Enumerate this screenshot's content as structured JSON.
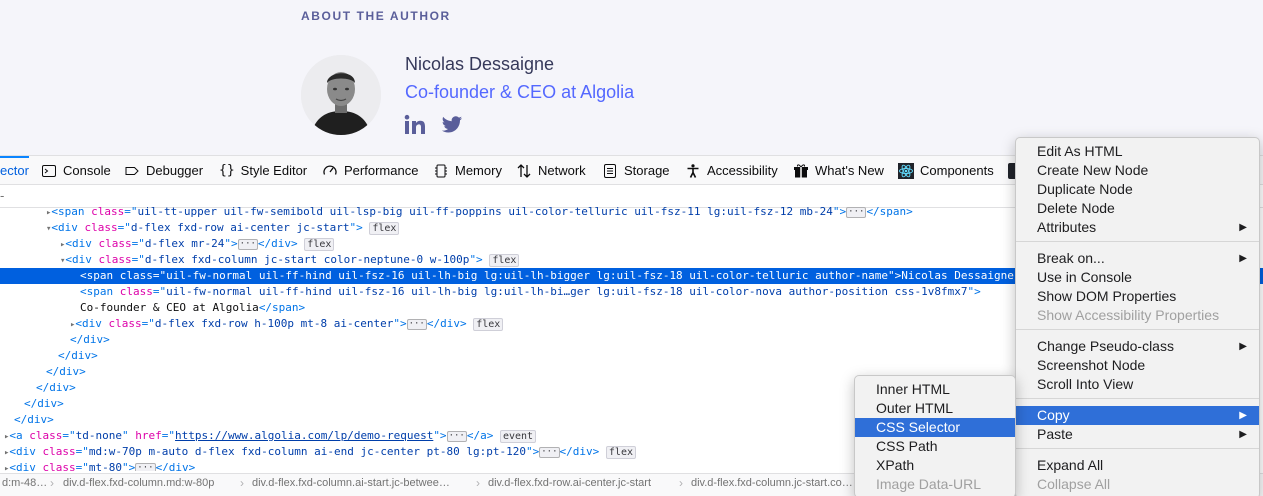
{
  "page": {
    "section_label": "ABOUT THE AUTHOR",
    "author_name": "Nicolas Dessaigne",
    "author_position": "Co-founder & CEO at Algolia",
    "colors": {
      "name": "#36395a",
      "position": "#5468ff",
      "section": "#5a5e9a",
      "social": "#5a5e9a"
    }
  },
  "toolbar": {
    "tabs": [
      {
        "label": "ector",
        "icon": "inspector-icon"
      },
      {
        "label": "Console",
        "icon": "console-icon"
      },
      {
        "label": "Debugger",
        "icon": "debugger-icon"
      },
      {
        "label": "Style Editor",
        "icon": "style-editor-icon"
      },
      {
        "label": "Performance",
        "icon": "performance-icon"
      },
      {
        "label": "Memory",
        "icon": "memory-icon"
      },
      {
        "label": "Network",
        "icon": "network-icon"
      },
      {
        "label": "Storage",
        "icon": "storage-icon"
      },
      {
        "label": "Accessibility",
        "icon": "accessibility-icon"
      },
      {
        "label": "What's New",
        "icon": "whats-new-icon"
      },
      {
        "label": "Components",
        "icon": "react-icon"
      }
    ],
    "active_tab": "ector",
    "search_placeholder": "-"
  },
  "markup": {
    "lines": [
      {
        "text_tag": "span",
        "class": "uil-tt-upper uil-fw-semibold uil-lsp-big uil-ff-poppins uil-color-telluric uil-fsz-11 lg:uil-fsz-12 mb-24",
        "close": "</span>"
      },
      {
        "text_tag": "div",
        "class": "d-flex fxd-row ai-center jc-start",
        "badge": "flex"
      },
      {
        "text_tag": "div",
        "class": "d-flex mr-24",
        "close": "</div>",
        "badge": "flex"
      },
      {
        "text_tag": "div",
        "class": "d-flex fxd-column jc-start color-neptune-0 w-100p",
        "badge": "flex"
      },
      {
        "text_tag": "span",
        "class": "uil-fw-normal uil-ff-hind uil-fsz-16 uil-lh-big lg:uil-lh-bigger lg:uil-fsz-18 uil-color-telluric author-name",
        "content": "Nicolas Dessaigne"
      },
      {
        "text_tag": "span",
        "class": "uil-fw-normal uil-ff-hind uil-fsz-16 uil-lh-big lg:uil-lh-bi…ger lg:uil-fsz-18 uil-color-nova author-position css-1v8fmx7"
      },
      {
        "content": "Co-founder & CEO at Algolia",
        "close": "</span>"
      },
      {
        "text_tag": "div",
        "class": "d-flex fxd-row h-100p mt-8 ai-center",
        "close": "</div>",
        "badge": "flex"
      },
      {
        "close": "</div>"
      },
      {
        "close": "</div>"
      },
      {
        "close": "</div>"
      },
      {
        "close": "</div>"
      },
      {
        "close": "</div>"
      },
      {
        "close": "</div>"
      },
      {
        "text_tag": "a",
        "class": "td-none",
        "href_label": "href",
        "href": "https://www.algolia.com/lp/demo-request",
        "close": "</a>",
        "badge": "event"
      },
      {
        "text_tag": "div",
        "class": "md:w-70p m-auto d-flex fxd-column ai-end jc-center pt-80 lg:pt-120",
        "close": "</div>",
        "badge": "flex"
      },
      {
        "text_tag": "div",
        "class": "mt-80",
        "close": "</div>"
      }
    ]
  },
  "breadcrumbs": [
    "d:m-48…",
    "div.d-flex.fxd-column.md:w-80p",
    "div.d-flex.fxd-column.ai-start.jc-betwee…",
    "div.d-flex.fxd-row.ai-center.jc-start",
    "div.d-flex.fxd-column.jc-start.co…"
  ],
  "main_menu": {
    "items": [
      {
        "label": "Edit As HTML"
      },
      {
        "label": "Create New Node"
      },
      {
        "label": "Duplicate Node"
      },
      {
        "label": "Delete Node"
      },
      {
        "label": "Attributes",
        "submenu": true
      },
      {
        "label": "Break on...",
        "submenu": true
      },
      {
        "label": "Use in Console"
      },
      {
        "label": "Show DOM Properties"
      },
      {
        "label": "Show Accessibility Properties",
        "disabled": true
      },
      {
        "label": "Change Pseudo-class",
        "submenu": true
      },
      {
        "label": "Screenshot Node"
      },
      {
        "label": "Scroll Into View"
      },
      {
        "label": "Copy",
        "submenu": true,
        "highlighted": true
      },
      {
        "label": "Paste",
        "submenu": true
      },
      {
        "label": "Expand All"
      },
      {
        "label": "Collapse All",
        "disabled": true
      }
    ]
  },
  "copy_submenu": {
    "items": [
      {
        "label": "Inner HTML"
      },
      {
        "label": "Outer HTML"
      },
      {
        "label": "CSS Selector",
        "highlighted": true
      },
      {
        "label": "CSS Path"
      },
      {
        "label": "XPath"
      },
      {
        "label": "Image Data-URL",
        "disabled": true
      }
    ]
  },
  "colors": {
    "menu_highlight": "#2f6fd8",
    "selection": "#0060df",
    "tag": "#0074e8",
    "attr_name": "#dd00a9",
    "attr_value": "#003eaa"
  }
}
